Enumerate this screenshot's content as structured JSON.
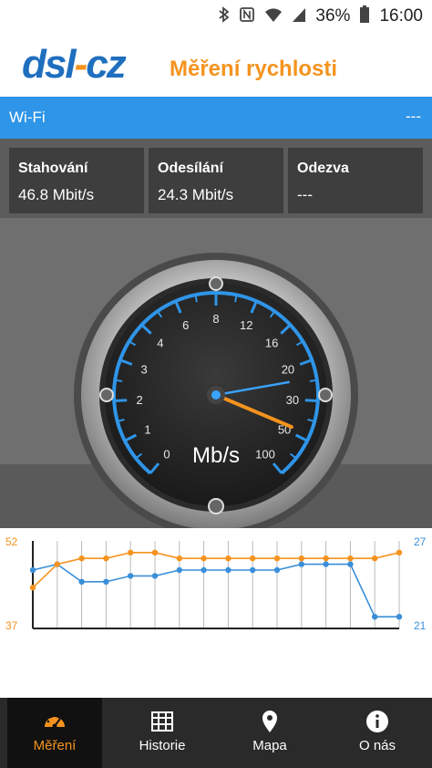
{
  "status_bar": {
    "battery": "36%",
    "time": "16:00",
    "icons": [
      "bluetooth-icon",
      "nfc-icon",
      "wifi-icon",
      "signal-icon",
      "battery-icon"
    ]
  },
  "app_bar": {
    "logo_left": "dsl",
    "logo_right": "cz",
    "title": "Měření rychlosti"
  },
  "network": {
    "label": "Wi-Fi",
    "value": "---"
  },
  "stats": [
    {
      "key": "Stahování",
      "value": "46.8 Mbit/s"
    },
    {
      "key": "Odesílání",
      "value": "24.3 Mbit/s"
    },
    {
      "key": "Odezva",
      "value": "---"
    }
  ],
  "gauge": {
    "unit": "Mb/s",
    "scale": [
      "0",
      "1",
      "2",
      "3",
      "4",
      "6",
      "8",
      "12",
      "16",
      "20",
      "30",
      "50",
      "100"
    ],
    "download_needle": 46.8,
    "upload_needle": 24.3
  },
  "chart": {
    "left_top": "52",
    "left_bottom": "37",
    "right_top": "27",
    "right_bottom": "21",
    "orange_series": [
      40,
      44,
      45,
      45,
      46,
      46,
      45,
      45,
      45,
      45,
      45,
      45,
      45,
      45,
      45,
      46
    ],
    "blue_series": [
      43,
      44,
      41,
      41,
      42,
      42,
      43,
      43,
      43,
      43,
      43,
      44,
      44,
      44,
      35,
      35
    ],
    "colors": {
      "orange": "#f5931e",
      "blue": "#3a8fd8"
    }
  },
  "nav": [
    {
      "label": "Měření",
      "icon": "speedometer-icon",
      "active": true
    },
    {
      "label": "Historie",
      "icon": "grid-icon",
      "active": false
    },
    {
      "label": "Mapa",
      "icon": "map-pin-icon",
      "active": false
    },
    {
      "label": "O nás",
      "icon": "info-icon",
      "active": false
    }
  ]
}
